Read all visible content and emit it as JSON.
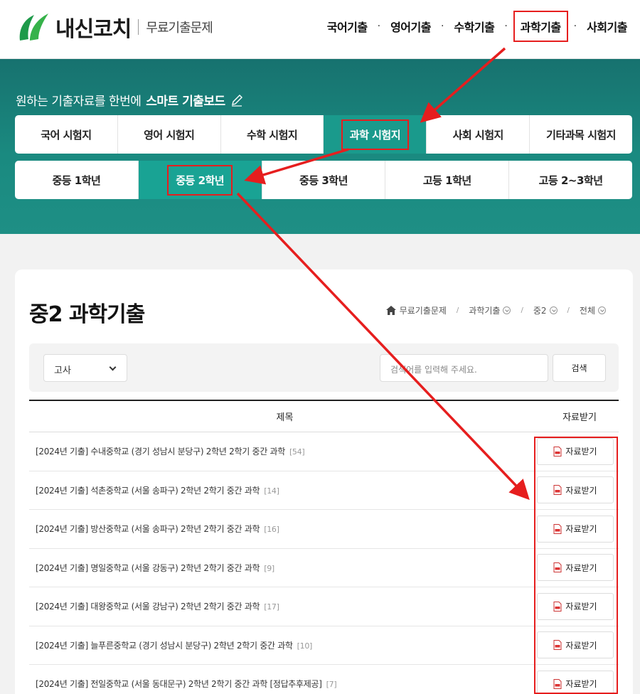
{
  "header": {
    "logo_text": "내신코치",
    "logo_sub": "무료기출문제",
    "nav": [
      "국어기출",
      "영어기출",
      "수학기출",
      "과학기출",
      "사회기출"
    ]
  },
  "hero": {
    "title_plain": "원하는 기출자료를 한번에",
    "title_bold": "스마트 기출보드"
  },
  "subject_tabs": [
    "국어 시험지",
    "영어 시험지",
    "수학 시험지",
    "과학 시험지",
    "사회 시험지",
    "기타과목 시험지"
  ],
  "grade_tabs": [
    "중등 1학년",
    "중등 2학년",
    "중등 3학년",
    "고등 1학년",
    "고등 2~3학년"
  ],
  "page": {
    "title": "중2 과학기출",
    "breadcrumb": [
      "무료기출문제",
      "과학기출",
      "중2",
      "전체"
    ]
  },
  "search": {
    "select_value": "고사",
    "placeholder": "검색어를 입력해 주세요.",
    "button": "검색"
  },
  "table": {
    "col_title": "제목",
    "col_download": "자료받기",
    "download_label": "자료받기",
    "rows": [
      {
        "title": "[2024년 기출] 수내중학교 (경기 성남시 분당구) 2학년 2학기 중간 과학",
        "count": "[54]"
      },
      {
        "title": "[2024년 기출] 석촌중학교 (서울 송파구) 2학년 2학기 중간 과학",
        "count": "[14]"
      },
      {
        "title": "[2024년 기출] 방산중학교 (서울 송파구) 2학년 2학기 중간 과학",
        "count": "[16]"
      },
      {
        "title": "[2024년 기출] 명일중학교 (서울 강동구) 2학년 2학기 중간 과학",
        "count": "[9]"
      },
      {
        "title": "[2024년 기출] 대왕중학교 (서울 강남구) 2학년 2학기 중간 과학",
        "count": "[17]"
      },
      {
        "title": "[2024년 기출] 늘푸른중학교 (경기 성남시 분당구) 2학년 2학기 중간 과학",
        "count": "[10]"
      },
      {
        "title": "[2024년 기출] 전일중학교 (서울 동대문구) 2학년 2학기 중간 과학 [정답추후제공]",
        "count": "[7]"
      }
    ]
  },
  "colors": {
    "accent": "#1a9a8c",
    "highlight": "#e61e1e"
  }
}
